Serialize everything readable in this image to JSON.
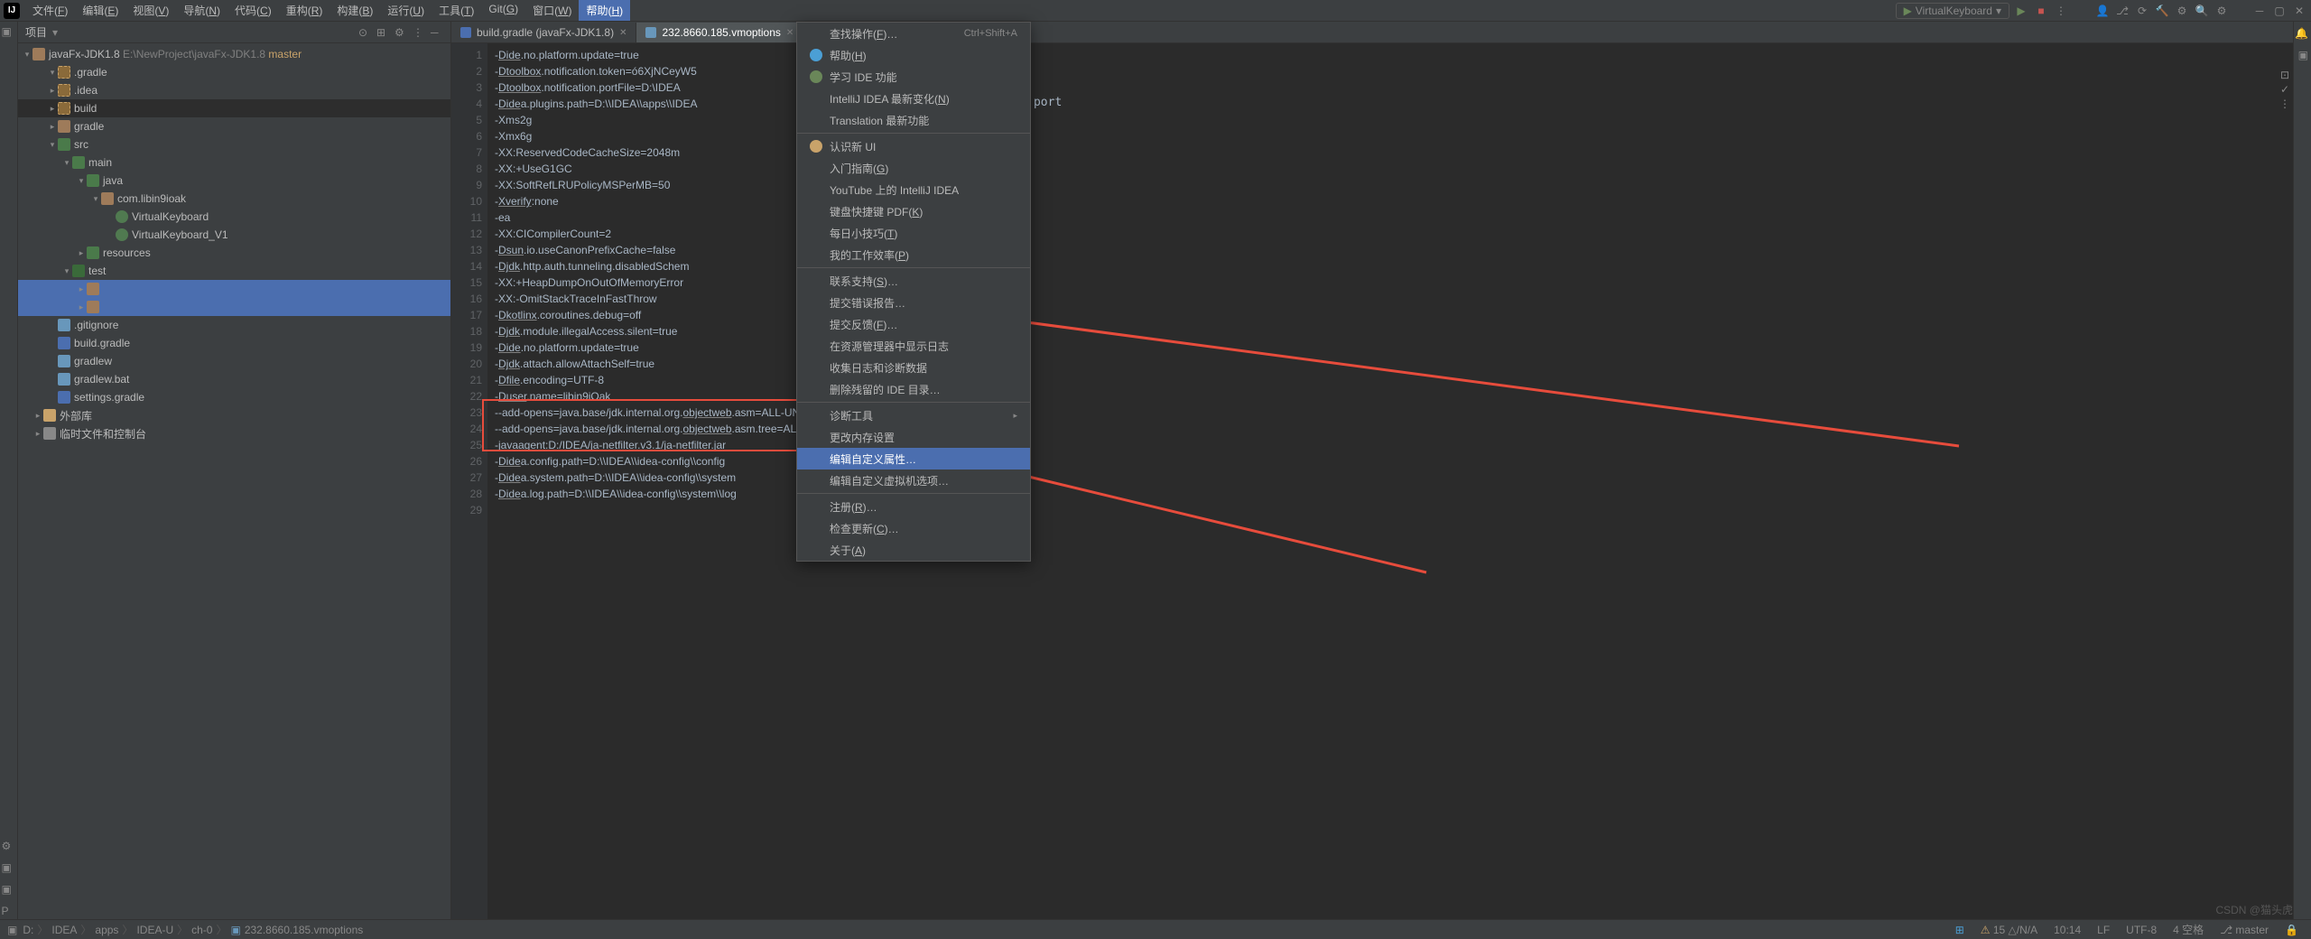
{
  "menubar": {
    "items": [
      "文件(F)",
      "编辑(E)",
      "视图(V)",
      "导航(N)",
      "代码(C)",
      "重构(R)",
      "构建(B)",
      "运行(U)",
      "工具(T)",
      "Git(G)",
      "窗口(W)",
      "帮助(H)"
    ],
    "active_index": 11,
    "run_config": "VirtualKeyboard"
  },
  "sidebar": {
    "title": "项目",
    "root": {
      "name": "javaFx-JDK1.8",
      "path": "E:\\NewProject\\javaFx-JDK1.8",
      "branch": "master"
    },
    "tree": [
      {
        "d": 1,
        "exp": true,
        "icon": "folder gen",
        "label": ".gradle"
      },
      {
        "d": 1,
        "exp": false,
        "icon": "folder gen",
        "label": ".idea"
      },
      {
        "d": 1,
        "exp": false,
        "icon": "folder gen",
        "label": "build",
        "sel": true
      },
      {
        "d": 1,
        "exp": false,
        "icon": "folder",
        "label": "gradle"
      },
      {
        "d": 1,
        "exp": true,
        "icon": "folder src",
        "label": "src"
      },
      {
        "d": 2,
        "exp": true,
        "icon": "folder src",
        "label": "main"
      },
      {
        "d": 3,
        "exp": true,
        "icon": "folder src",
        "label": "java"
      },
      {
        "d": 4,
        "exp": true,
        "icon": "folder",
        "label": "com.libin9ioak"
      },
      {
        "d": 5,
        "exp": false,
        "icon": "file-j",
        "label": "VirtualKeyboard",
        "class": true
      },
      {
        "d": 5,
        "exp": false,
        "icon": "file-j",
        "label": "VirtualKeyboard_V1",
        "class": true
      },
      {
        "d": 3,
        "exp": false,
        "icon": "folder src",
        "label": "resources"
      },
      {
        "d": 2,
        "exp": true,
        "icon": "folder test",
        "label": "test"
      },
      {
        "d": 3,
        "exp": false,
        "icon": "folder",
        "label": "",
        "hi": true
      },
      {
        "d": 3,
        "exp": false,
        "icon": "folder",
        "label": "",
        "hi": true
      },
      {
        "d": 1,
        "exp": false,
        "icon": "file-t",
        "label": ".gitignore"
      },
      {
        "d": 1,
        "exp": false,
        "icon": "file-g",
        "label": "build.gradle"
      },
      {
        "d": 1,
        "exp": false,
        "icon": "file-t",
        "label": "gradlew"
      },
      {
        "d": 1,
        "exp": false,
        "icon": "file-t",
        "label": "gradlew.bat"
      },
      {
        "d": 1,
        "exp": false,
        "icon": "file-g",
        "label": "settings.gradle"
      },
      {
        "d": 0,
        "exp": false,
        "icon": "lib",
        "label": "外部库"
      },
      {
        "d": 0,
        "exp": false,
        "icon": "scratch",
        "label": "临时文件和控制台"
      }
    ]
  },
  "tabs": [
    {
      "label": "build.gradle (javaFx-JDK1.8)",
      "active": false
    },
    {
      "label": "232.8660.185.vmoptions",
      "active": true
    }
  ],
  "editor": {
    "visible_tail": "tions.port",
    "lines": [
      "-Dide.no.platform.update=true",
      "-Dtoolbox.notification.token=ó6XjNCeyW5",
      "-Dtoolbox.notification.portFile=D:\\IDEA",
      "-Didea.plugins.path=D:\\\\IDEA\\\\apps\\\\IDEA",
      "-Xms2g",
      "-Xmx6g",
      "-XX:ReservedCodeCacheSize=2048m",
      "-XX:+UseG1GC",
      "-XX:SoftRefLRUPolicyMSPerMB=50",
      "-Xverify:none",
      "-ea",
      "-XX:CICompilerCount=2",
      "-Dsun.io.useCanonPrefixCache=false",
      "-Djdk.http.auth.tunneling.disabledSchem",
      "-XX:+HeapDumpOnOutOfMemoryError",
      "-XX:-OmitStackTraceInFastThrow",
      "-Dkotlinx.coroutines.debug=off",
      "-Djdk.module.illegalAccess.silent=true",
      "-Dide.no.platform.update=true",
      "-Djdk.attach.allowAttachSelf=true",
      "-Dfile.encoding=UTF-8",
      "-Duser.name=libin9iOak",
      "--add-opens=java.base/jdk.internal.org.objectweb.asm=ALL-UNNAMED",
      "--add-opens=java.base/jdk.internal.org.objectweb.asm.tree=ALL-UNNAMED",
      "-javaagent:D:/IDEA/ja-netfilter.v3.1/ja-netfilter.jar",
      "-Didea.config.path=D:\\\\IDEA\\\\idea-config\\\\config",
      "-Didea.system.path=D:\\\\IDEA\\\\idea-config\\\\system",
      "-Didea.log.path=D:\\\\IDEA\\\\idea-config\\\\system\\\\log",
      ""
    ]
  },
  "help_menu": {
    "items": [
      {
        "label": "查找操作(F)…",
        "shortcut": "Ctrl+Shift+A"
      },
      {
        "label": "帮助(H)",
        "icon": "help"
      },
      {
        "label": "学习 IDE 功能",
        "icon": "learn"
      },
      {
        "label": "IntelliJ IDEA 最新变化(N)"
      },
      {
        "label": "Translation 最新功能"
      },
      {
        "sep": true
      },
      {
        "label": "认识新 UI",
        "icon": "newui"
      },
      {
        "label": "入门指南(G)"
      },
      {
        "label": "YouTube 上的 IntelliJ IDEA"
      },
      {
        "label": "键盘快捷键 PDF(K)"
      },
      {
        "label": "每日小技巧(T)"
      },
      {
        "label": "我的工作效率(P)"
      },
      {
        "sep": true
      },
      {
        "label": "联系支持(S)…"
      },
      {
        "label": "提交错误报告…"
      },
      {
        "label": "提交反馈(F)…"
      },
      {
        "label": "在资源管理器中显示日志"
      },
      {
        "label": "收集日志和诊断数据"
      },
      {
        "label": "删除残留的 IDE 目录…"
      },
      {
        "sep": true
      },
      {
        "label": "诊断工具",
        "sub": true
      },
      {
        "label": "更改内存设置"
      },
      {
        "label": "编辑自定义属性…",
        "hi": true
      },
      {
        "label": "编辑自定义虚拟机选项…"
      },
      {
        "sep": true
      },
      {
        "label": "注册(R)…"
      },
      {
        "label": "检查更新(C)…"
      },
      {
        "label": "关于(A)"
      }
    ]
  },
  "statusbar": {
    "breadcrumbs": [
      "D:",
      "IDEA",
      "apps",
      "IDEA-U",
      "ch-0",
      "232.8660.185.vmoptions"
    ],
    "right": [
      "15 △/N/A",
      "10:14",
      "LF",
      "UTF-8",
      "4 空格",
      "master"
    ]
  },
  "watermark": "CSDN @猫头虎"
}
